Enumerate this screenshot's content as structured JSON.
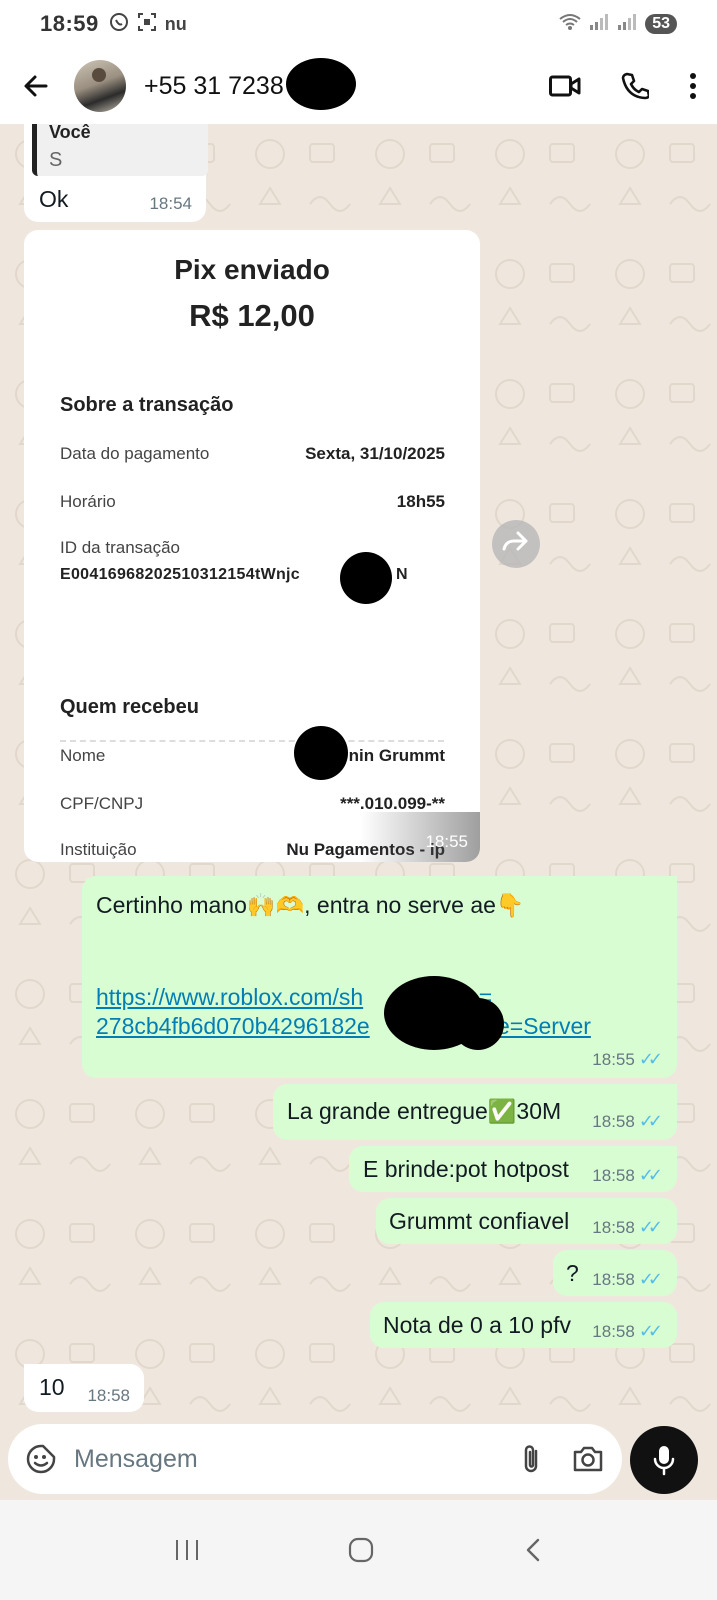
{
  "status_bar": {
    "time": "18:59",
    "carrier": "nu",
    "battery": "53"
  },
  "header": {
    "contact": "+55 31 7238"
  },
  "messages": {
    "m1": {
      "quote_author": "Você",
      "quote_text": "S",
      "text": "Ok",
      "time": "18:54"
    },
    "receipt": {
      "title": "Pix enviado",
      "amount": "R$ 12,00",
      "section1": "Sobre a transação",
      "date_label": "Data do pagamento",
      "date_value": "Sexta, 31/10/2025",
      "hour_label": "Horário",
      "hour_value": "18h55",
      "id_label": "ID da transação",
      "id_value": "E00416968202510312154tWnjc",
      "id_suffix": "N",
      "section2": "Quem recebeu",
      "name_label": "Nome",
      "name_value": "nin Grummt",
      "cpf_label": "CPF/CNPJ",
      "cpf_value": "***.010.099-**",
      "inst_label": "Instituição",
      "inst_value": "Nu Pagamentos - ip",
      "time": "18:55"
    },
    "m2": {
      "text": "Certinho mano🙌🫶, entra no serve ae👇",
      "link_line1": "https://www.roblox.com/sh",
      "link_line1_end": "de=",
      "link_line2": "278cb4fb6d070b4296182e",
      "link_line2_end": "ef&type=Server",
      "time": "18:55"
    },
    "m3": {
      "text": "La grande entregue✅30M",
      "time": "18:58"
    },
    "m4": {
      "text": "E brinde:pot hotpost",
      "time": "18:58"
    },
    "m5": {
      "text": "Grummt confiavel",
      "time": "18:58"
    },
    "m6": {
      "text": "?",
      "time": "18:58"
    },
    "m7": {
      "text": "Nota de 0 a 10 pfv",
      "time": "18:58"
    },
    "m8": {
      "text": "10",
      "time": "18:58"
    }
  },
  "input": {
    "placeholder": "Mensagem"
  },
  "colors": {
    "outgoing": "#d9fdd3",
    "incoming": "#ffffff",
    "read_ticks": "#53bdeb",
    "link": "#027eb5"
  }
}
